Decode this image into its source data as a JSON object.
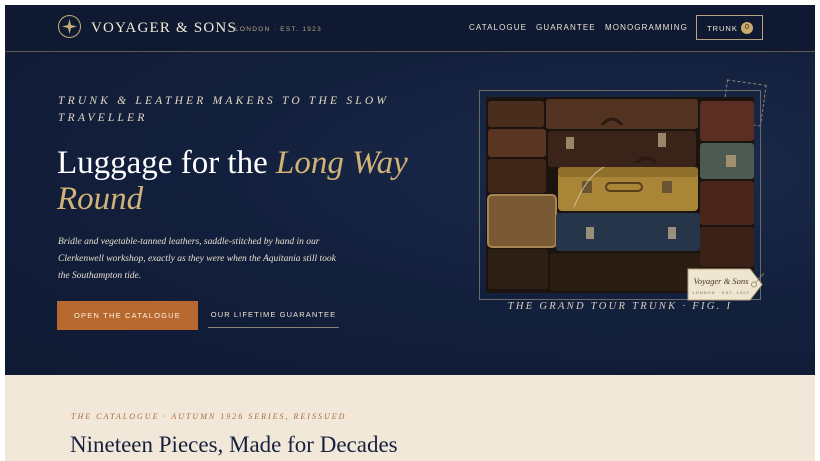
{
  "colors": {
    "navy": "#13203d",
    "gold": "#d2b377",
    "copper": "#b7692f",
    "cream": "#f1e8d9"
  },
  "nav": {
    "logo_icon": "compass-star-icon",
    "brand": "VOYAGER & SONS",
    "brand_sub": "LONDON · EST. 1923",
    "links": [
      "CATALOGUE",
      "GUARANTEE",
      "MONOGRAMMING"
    ],
    "trunk_label": "TRUNK",
    "trunk_count": "0"
  },
  "hero": {
    "eyebrow": "TRUNK & LEATHER MAKERS TO THE SLOW TRAVELLER",
    "headline_plain": "Luggage for the ",
    "headline_accent": "Long Way Round",
    "lede": "Bridle and vegetable-tanned leathers, saddle-stitched by hand in our Clerkenwell workshop, exactly as they were when the Aquitania still took the Southampton tide.",
    "cta_primary": "OPEN THE CATALOGUE",
    "cta_secondary": "OUR LIFETIME GUARANTEE",
    "photo": {
      "alt_icon": "stacked-suitcases-photo",
      "tag_name": "Voyager & Sons",
      "tag_sub": "LONDON · EST. 1923",
      "caption": "THE GRAND TOUR TRUNK · FIG. I"
    }
  },
  "catalogue": {
    "eyebrow": "THE CATALOGUE · AUTUMN 1926 SERIES, REISSUED",
    "title": "Nineteen Pieces, Made for Decades"
  }
}
